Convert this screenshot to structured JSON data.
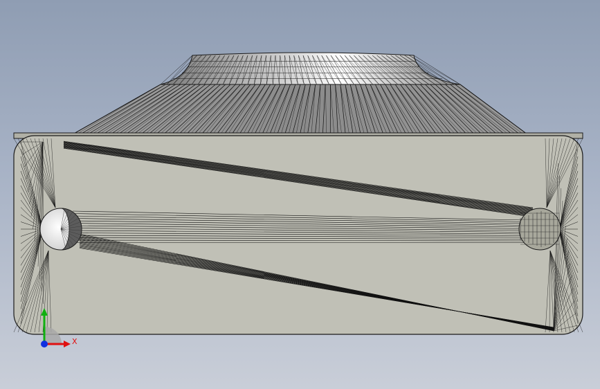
{
  "viewport": {
    "background_top": "#8f9db3",
    "background_bottom": "#c9ced8"
  },
  "model": {
    "body_fill": "#c0c0b6",
    "body_edge": "#1a1a1a",
    "cone_fill": "#909090",
    "neck_fill": "#b8b8b8",
    "hole_fill": "#f4f4f4",
    "boss_fill": "#a8a89c"
  },
  "triad": {
    "x_label": "X",
    "x_color": "#e01010",
    "y_color": "#10b010",
    "origin_color": "#1030e0"
  }
}
